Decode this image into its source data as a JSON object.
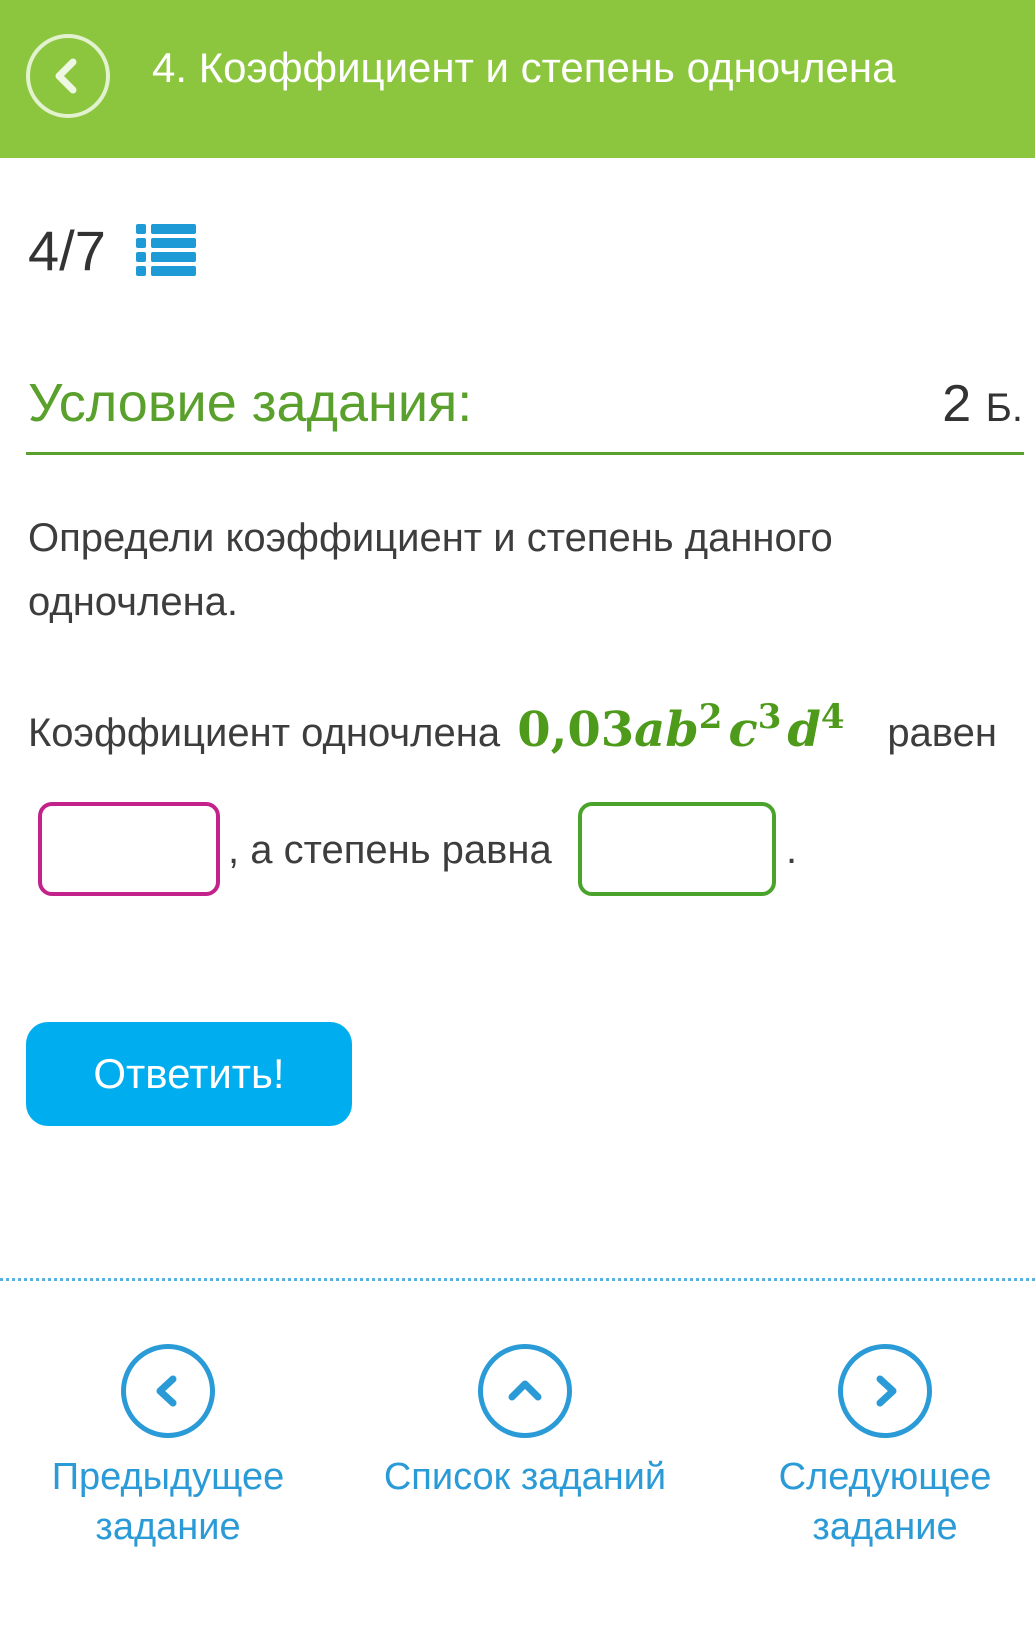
{
  "header": {
    "title": "4. Коэффициент и степень одночлена",
    "back_icon": "chevron-left-icon",
    "background_color": "#8cc63f"
  },
  "progress": {
    "label": "4/7",
    "list_icon": "list-icon"
  },
  "task": {
    "section_title": "Условие задания:",
    "points_value": "2",
    "points_unit": "Б.",
    "instruction": "Определи коэффициент и степень данного одночлена.",
    "formula_prefix": "Коэффициент одночлена",
    "formula": {
      "coefficient": "0,03",
      "var1": "a",
      "var2": "b",
      "exp2": "2",
      "var3": "c",
      "exp3": "3",
      "var4": "d",
      "exp4": "4"
    },
    "formula_suffix": "равен",
    "middle_text": ", а степень равна",
    "end_text": ".",
    "coefficient_input_value": "",
    "degree_input_value": ""
  },
  "submit_label": "Ответить!",
  "nav": {
    "prev_label_1": "Предыдущее",
    "prev_label_2": "задание",
    "list_label": "Список заданий",
    "next_label_1": "Следующее",
    "next_label_2": "задание"
  },
  "colors": {
    "accent_green": "#5aa02c",
    "button_blue": "#00aeef",
    "nav_blue": "#2a9bd6",
    "coefficient_border": "#c2228a",
    "degree_border": "#4aa32a"
  }
}
